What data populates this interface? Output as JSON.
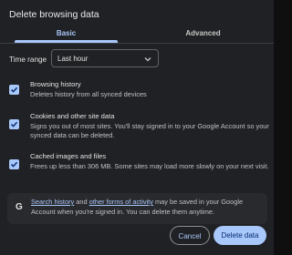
{
  "dialog": {
    "title": "Delete browsing data",
    "tabs": [
      {
        "label": "Basic",
        "selected": true
      },
      {
        "label": "Advanced",
        "selected": false
      }
    ],
    "time_range": {
      "label": "Time range",
      "value": "Last hour",
      "icon": "chevron-down-icon"
    },
    "options": [
      {
        "title": "Browsing history",
        "description": "Deletes history from all synced devices",
        "checked": true
      },
      {
        "title": "Cookies and other site data",
        "description": "Signs you out of most sites. You'll stay signed in to your Google Account so your synced data can be deleted.",
        "checked": true
      },
      {
        "title": "Cached images and files",
        "description": "Frees up less than 306 MB. Some sites may load more slowly on your next visit.",
        "checked": true
      }
    ],
    "info": {
      "icon": "google-icon",
      "g_glyph": "G",
      "link1": "Search history",
      "mid": " and ",
      "link2": "other forms of activity",
      "rest": " may be saved in your Google Account when you're signed in. You can delete them anytime."
    },
    "buttons": {
      "cancel": "Cancel",
      "delete": "Delete data"
    },
    "colors": {
      "accent": "#a8c7fa",
      "background": "#202124"
    }
  }
}
